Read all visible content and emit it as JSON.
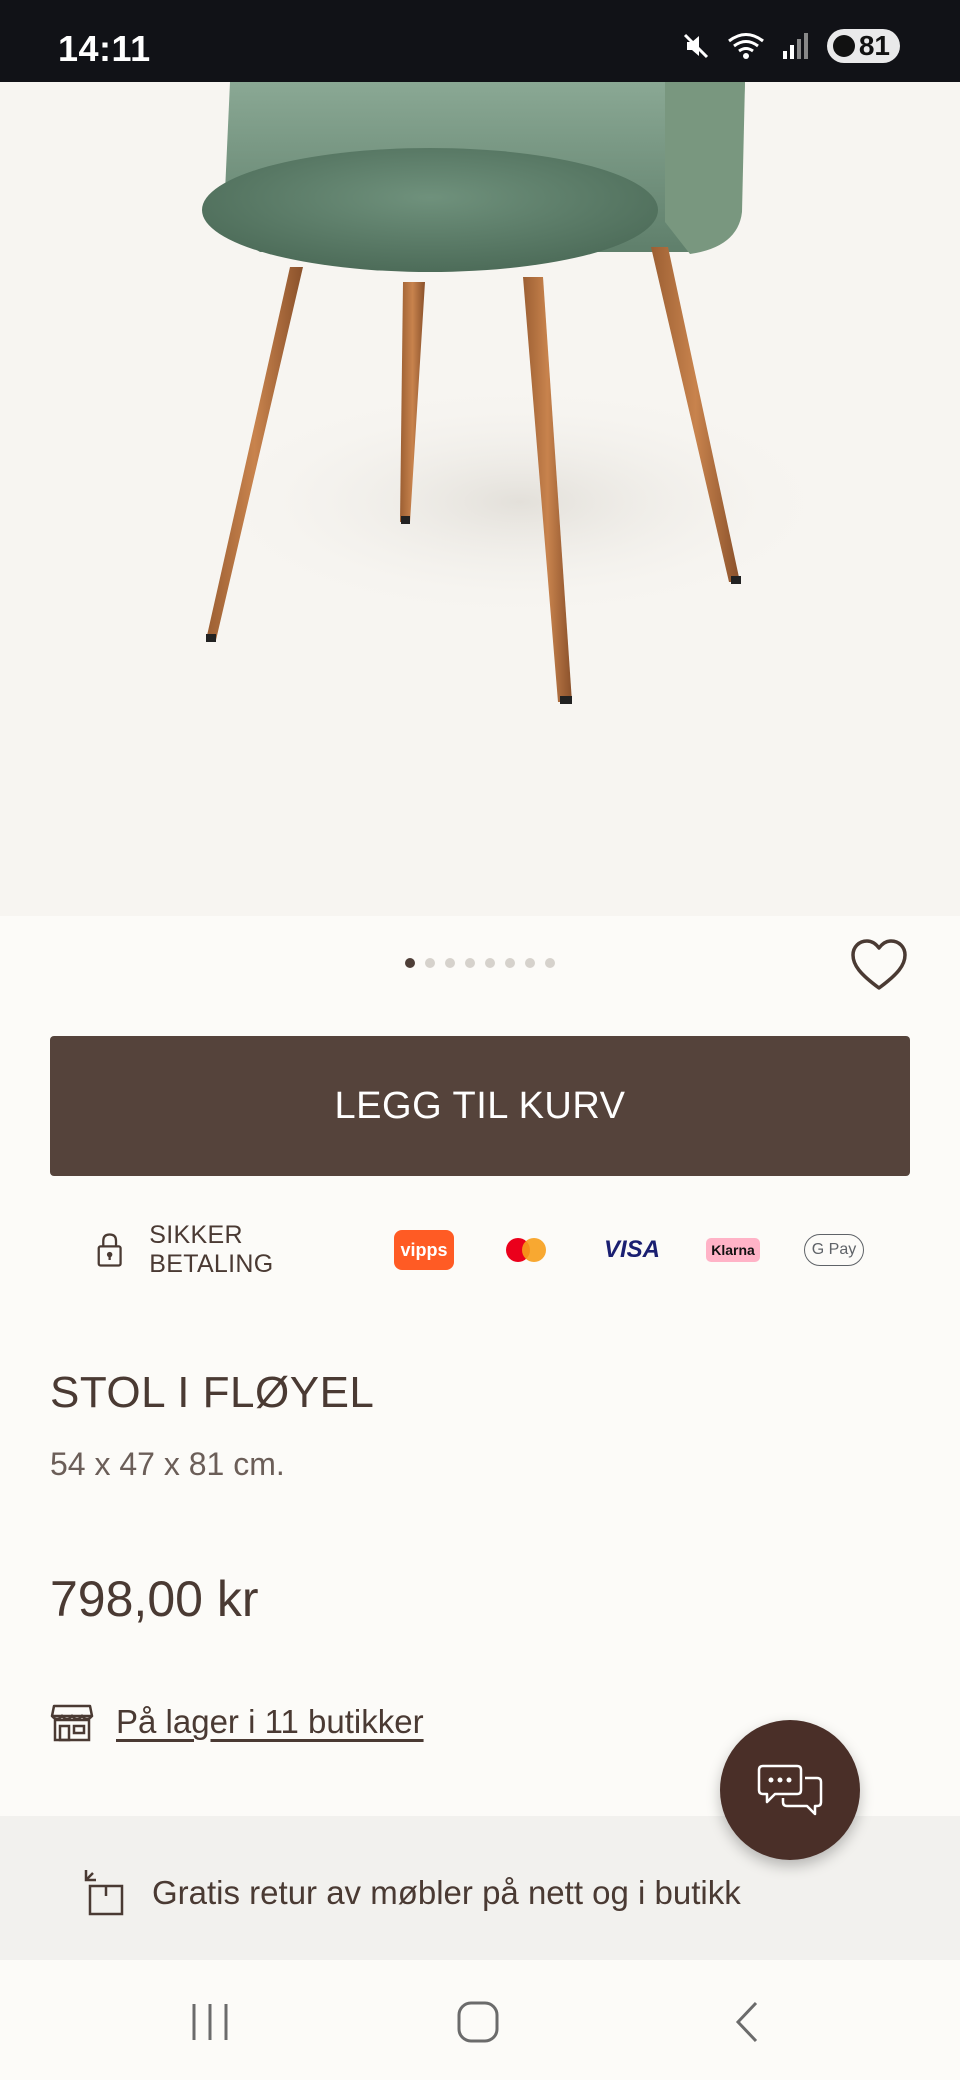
{
  "status_bar": {
    "time": "14:11",
    "battery": "81",
    "icons": [
      "mute-icon",
      "wifi-icon",
      "signal-icon",
      "battery-icon"
    ]
  },
  "product_image": {
    "description_icon": "chair-photo",
    "carousel": {
      "count": 8,
      "active_index": 0
    }
  },
  "actions": {
    "add_to_cart": "LEGG TIL KURV",
    "wishlist_icon": "heart-icon"
  },
  "payment": {
    "secure_label": "SIKKER BETALING",
    "vipps": "vipps",
    "visa": "VISA",
    "klarna": "Klarna",
    "gpay": "G Pay"
  },
  "product": {
    "title": "STOL I FLØYEL",
    "dimensions": "54 x 47 x 81 cm.",
    "price": "798,00 kr"
  },
  "stock": {
    "label": "På lager i 11 butikker"
  },
  "return_banner": {
    "text": "Gratis retur av møbler på nett og i butikk"
  },
  "colors": {
    "brand_brown": "#55433b",
    "text": "#4a3a33",
    "chat_fab": "#4a2f28"
  }
}
